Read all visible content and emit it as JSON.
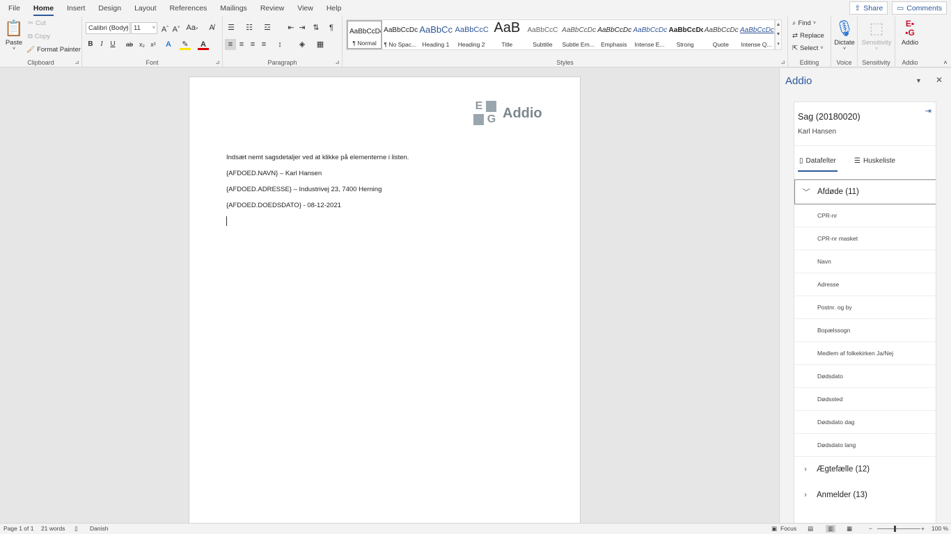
{
  "menu": {
    "tabs": [
      "File",
      "Home",
      "Insert",
      "Design",
      "Layout",
      "References",
      "Mailings",
      "Review",
      "View",
      "Help"
    ],
    "active": "Home",
    "share": "Share",
    "comments": "Comments"
  },
  "ribbon": {
    "clipboard": {
      "label": "Clipboard",
      "paste": "Paste",
      "cut": "Cut",
      "copy": "Copy",
      "format_painter": "Format Painter"
    },
    "font": {
      "label": "Font",
      "family": "Calibri (Body)",
      "size": "11",
      "grow": "A^",
      "shrink": "A˅",
      "case": "Aa",
      "bold": "B",
      "italic": "I",
      "underline": "U",
      "strike": "ab",
      "sub": "x₂",
      "sup": "x²"
    },
    "paragraph": {
      "label": "Paragraph"
    },
    "styles": {
      "label": "Styles",
      "items": [
        {
          "preview": "AaBbCcDc",
          "name": "¶ Normal"
        },
        {
          "preview": "AaBbCcDc",
          "name": "¶ No Spac..."
        },
        {
          "preview": "AaBbCc",
          "name": "Heading 1"
        },
        {
          "preview": "AaBbCcC",
          "name": "Heading 2"
        },
        {
          "preview": "AaB",
          "name": "Title"
        },
        {
          "preview": "AaBbCcC",
          "name": "Subtitle"
        },
        {
          "preview": "AaBbCcDc",
          "name": "Subtle Em..."
        },
        {
          "preview": "AaBbCcDc",
          "name": "Emphasis"
        },
        {
          "preview": "AaBbCcDc",
          "name": "Intense E..."
        },
        {
          "preview": "AaBbCcDc",
          "name": "Strong"
        },
        {
          "preview": "AaBbCcDc",
          "name": "Quote"
        },
        {
          "preview": "AaBbCcDc",
          "name": "Intense Q..."
        }
      ]
    },
    "editing": {
      "label": "Editing",
      "find": "Find",
      "replace": "Replace",
      "select": "Select"
    },
    "voice": {
      "label": "Voice",
      "dictate": "Dictate"
    },
    "sensitivity": {
      "label": "Sensitivity",
      "button": "Sensitivity"
    },
    "addio": {
      "label": "Addio",
      "button": "Addio"
    }
  },
  "document": {
    "logo_text": "Addio",
    "lines": [
      "Indsæt nemt sagsdetaljer ved at klikke på elementerne i listen.",
      "{AFDOED.NAVN} – Karl Hansen",
      "{AFDOED.ADRESSE} – Industrivej 23, 7400 Herning",
      "{AFDOED.DOEDSDATO} - 08-12-2021"
    ]
  },
  "pane": {
    "title": "Addio",
    "case_title": "Sag (20180020)",
    "person": "Karl Hansen",
    "tabs": [
      "Datafelter",
      "Huskeliste"
    ],
    "sections": [
      {
        "name": "Afdøde (11)",
        "open": true,
        "items": [
          "CPR-nr",
          "CPR-nr masket",
          "Navn",
          "Adresse",
          "Postnr. og by",
          "Bopælssogn",
          "Medlem af folkekirken Ja/Nej",
          "Dødsdato",
          "Dødssted",
          "Dødsdato dag",
          "Dødsdato lang"
        ]
      },
      {
        "name": "Ægtefælle (12)",
        "open": false
      },
      {
        "name": "Anmelder (13)",
        "open": false
      }
    ]
  },
  "status": {
    "page": "Page 1 of 1",
    "words": "21 words",
    "lang": "Danish",
    "focus": "Focus",
    "zoom": "100 %"
  }
}
